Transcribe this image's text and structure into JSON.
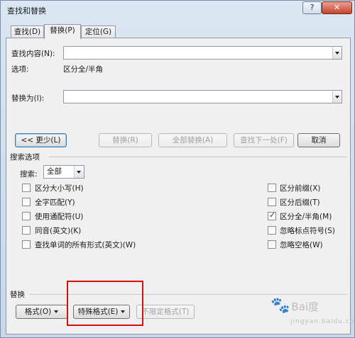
{
  "window": {
    "title": "查找和替换",
    "help_label": "?",
    "close_label": "✕"
  },
  "tabs": [
    {
      "label": "查找(D)",
      "active": false
    },
    {
      "label": "替换(P)",
      "active": true
    },
    {
      "label": "定位(G)",
      "active": false
    }
  ],
  "find": {
    "label": "查找内容(N):",
    "value": "",
    "options_label": "选项:",
    "options_value": "区分全/半角"
  },
  "replace": {
    "label": "替换为(I):",
    "value": ""
  },
  "buttons": {
    "less": "<< 更少(L)",
    "replace": "替换(R)",
    "replace_all": "全部替换(A)",
    "find_next": "查找下一处(F)",
    "cancel": "取消"
  },
  "search_options": {
    "heading": "搜索选项",
    "search_label": "搜索:",
    "search_value": "全部",
    "left_options": [
      {
        "label": "区分大小写(H)",
        "checked": false
      },
      {
        "label": "全字匹配(Y)",
        "checked": false
      },
      {
        "label": "使用通配符(U)",
        "checked": false
      },
      {
        "label": "同音(英文)(K)",
        "checked": false
      },
      {
        "label": "查找单词的所有形式(英文)(W)",
        "checked": false
      }
    ],
    "right_options": [
      {
        "label": "区分前缀(X)",
        "checked": false
      },
      {
        "label": "区分后缀(T)",
        "checked": false
      },
      {
        "label": "区分全/半角(M)",
        "checked": true
      },
      {
        "label": "忽略标点符号(S)",
        "checked": false
      },
      {
        "label": "忽略空格(W)",
        "checked": false
      }
    ]
  },
  "replace_section": {
    "heading": "替换",
    "format_label": "格式(O)",
    "special_label": "特殊格式(E)",
    "no_format_label": "不限定格式(T)"
  },
  "watermark": {
    "text": "Bai度",
    "sub": "jingyan.baidu.com"
  },
  "colors": {
    "highlight": "#d01212",
    "accent_focus": "#3c7fb1"
  }
}
